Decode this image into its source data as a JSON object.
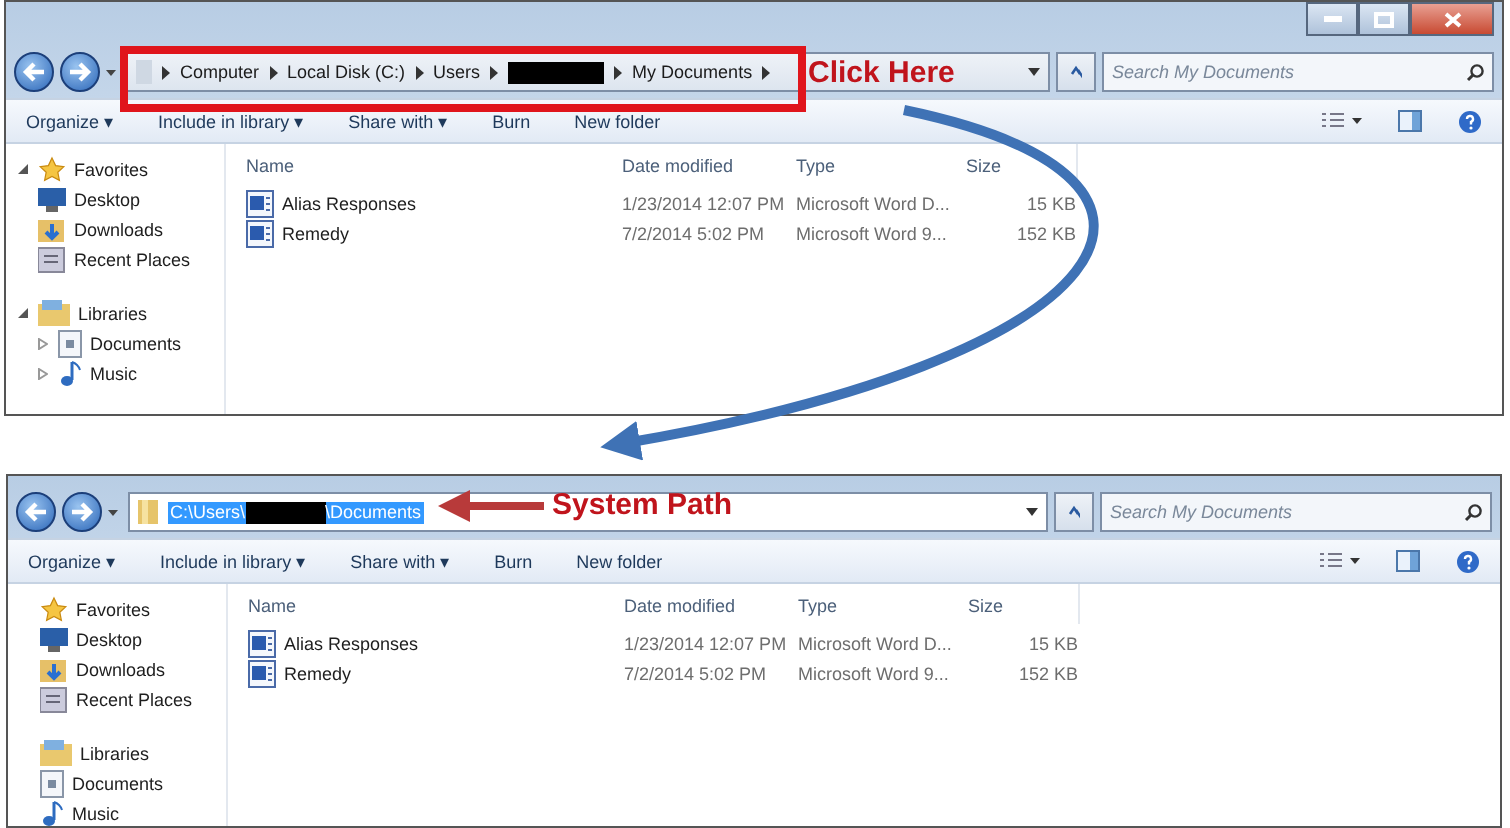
{
  "windows": [
    {
      "window_buttons": [
        {
          "kind": "minimize"
        },
        {
          "kind": "maximize"
        },
        {
          "kind": "close"
        }
      ],
      "address": {
        "kind": "breadcrumb",
        "segments": [
          {
            "kind": "text",
            "label": "Computer"
          },
          {
            "kind": "text",
            "label": "Local Disk (C:)"
          },
          {
            "kind": "text",
            "label": "Users"
          },
          {
            "kind": "redacted"
          },
          {
            "kind": "text",
            "label": "My Documents"
          }
        ]
      },
      "search": {
        "placeholder": "Search My Documents"
      },
      "toolbar": [
        "Organize ▾",
        "Include in library ▾",
        "Share with ▾",
        "Burn",
        "New folder"
      ],
      "nav": [
        {
          "label": "Favorites",
          "expanded": true,
          "kind": "star",
          "children": [
            {
              "label": "Desktop",
              "kind": "desktop"
            },
            {
              "label": "Downloads",
              "kind": "download"
            },
            {
              "label": "Recent Places",
              "kind": "recent"
            }
          ]
        },
        {
          "label": "Libraries",
          "expanded": true,
          "kind": "library",
          "children": [
            {
              "label": "Documents",
              "kind": "doc",
              "expanded": false
            },
            {
              "label": "Music",
              "kind": "music",
              "expanded": false
            }
          ]
        }
      ],
      "columns": [
        "Name",
        "Date modified",
        "Type",
        "Size"
      ],
      "rows": [
        {
          "name": "Alias Responses",
          "date": "1/23/2014 12:07 PM",
          "type": "Microsoft Word D...",
          "size": "15 KB"
        },
        {
          "name": "Remedy",
          "date": "7/2/2014 5:02 PM",
          "type": "Microsoft Word 9...",
          "size": "152 KB"
        }
      ]
    },
    {
      "address": {
        "kind": "path",
        "before": "C:\\Users\\",
        "after": "\\Documents",
        "selected": true
      },
      "search": {
        "placeholder": "Search My Documents"
      },
      "toolbar": [
        "Organize ▾",
        "Include in library ▾",
        "Share with ▾",
        "Burn",
        "New folder"
      ],
      "nav": [
        {
          "label": "Favorites",
          "kind": "star",
          "children": [
            {
              "label": "Desktop",
              "kind": "desktop"
            },
            {
              "label": "Downloads",
              "kind": "download"
            },
            {
              "label": "Recent Places",
              "kind": "recent"
            }
          ]
        },
        {
          "label": "Libraries",
          "kind": "library",
          "children": [
            {
              "label": "Documents",
              "kind": "doc"
            },
            {
              "label": "Music",
              "kind": "music"
            }
          ]
        }
      ],
      "columns": [
        "Name",
        "Date modified",
        "Type",
        "Size"
      ],
      "rows": [
        {
          "name": "Alias Responses",
          "date": "1/23/2014 12:07 PM",
          "type": "Microsoft Word D...",
          "size": "15 KB"
        },
        {
          "name": "Remedy",
          "date": "7/2/2014 5:02 PM",
          "type": "Microsoft Word 9...",
          "size": "152 KB"
        }
      ]
    }
  ],
  "callouts": [
    {
      "label": "Click Here"
    },
    {
      "label": "System Path"
    }
  ]
}
